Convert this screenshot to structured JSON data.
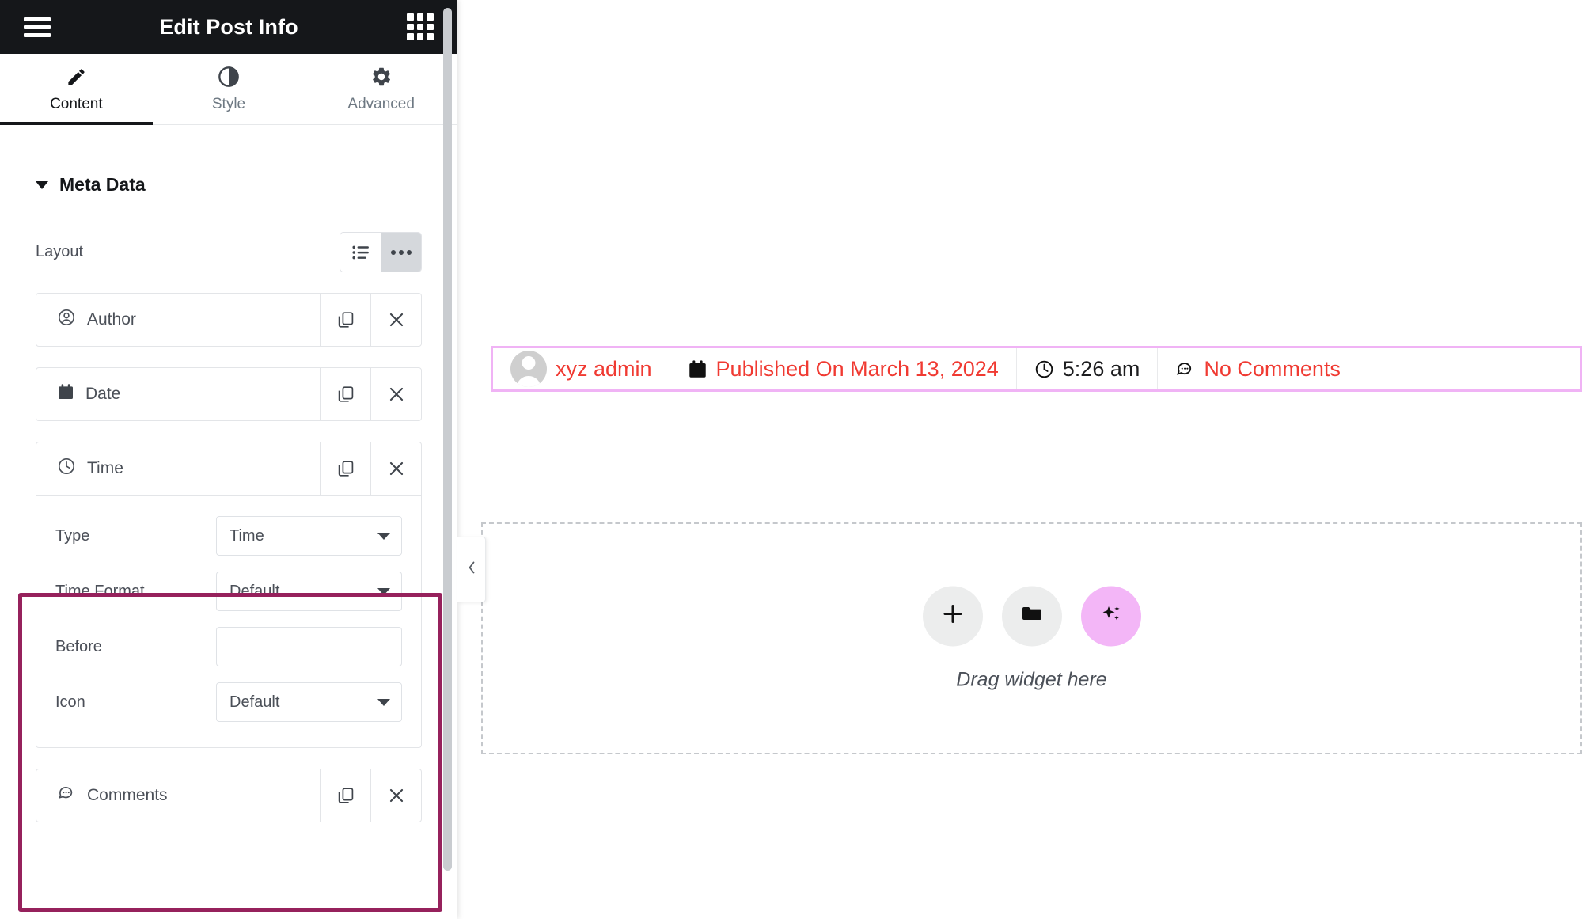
{
  "panel": {
    "header": {
      "title": "Edit Post Info",
      "menu_icon": "hamburger-icon",
      "apps_icon": "grid-apps-icon"
    },
    "tabs": [
      {
        "label": "Content",
        "icon": "pencil-icon",
        "active": true
      },
      {
        "label": "Style",
        "icon": "contrast-icon",
        "active": false
      },
      {
        "label": "Advanced",
        "icon": "gear-icon",
        "active": false
      }
    ],
    "section": {
      "title": "Meta Data",
      "collapsed": false
    },
    "layout_control": {
      "label": "Layout",
      "options": [
        "list",
        "inline"
      ],
      "selected": "inline"
    },
    "items": [
      {
        "label": "Author",
        "icon": "user-circle-icon",
        "open": false
      },
      {
        "label": "Date",
        "icon": "calendar-icon",
        "open": false
      },
      {
        "label": "Time",
        "icon": "clock-icon",
        "open": true,
        "fields": [
          {
            "label": "Type",
            "control": "select",
            "value": "Time"
          },
          {
            "label": "Time Format",
            "control": "select",
            "value": "Default"
          },
          {
            "label": "Before",
            "control": "text",
            "value": "",
            "placeholder": "",
            "dynamic_icon": "database-icon"
          },
          {
            "label": "Icon",
            "control": "select",
            "value": "Default"
          }
        ]
      },
      {
        "label": "Comments",
        "icon": "comment-dots-icon",
        "open": false
      }
    ],
    "row_actions": {
      "duplicate_icon": "copy-icon",
      "remove_icon": "close-x-icon"
    },
    "highlight_color": "#96215c",
    "collapse_handle_icon": "chevron-left-icon"
  },
  "canvas": {
    "meta_bar": {
      "border_color": "#f0b3f5",
      "text_color": "#f03a32",
      "items": [
        {
          "icon": "avatar-image",
          "text": "xyz admin",
          "color": "red"
        },
        {
          "icon": "calendar-icon",
          "text": "Published On March 13, 2024",
          "color": "red"
        },
        {
          "icon": "clock-icon",
          "text": "5:26 am",
          "color": "dark"
        },
        {
          "icon": "comment-dots-icon",
          "text": "No Comments",
          "color": "red"
        }
      ]
    },
    "annotation_arrow": {
      "color": "#96215c",
      "points_to": "5:26 am"
    },
    "dropzone": {
      "text": "Drag widget here",
      "buttons": [
        {
          "icon": "plus-icon",
          "style": "gray"
        },
        {
          "icon": "folder-icon",
          "style": "gray"
        },
        {
          "icon": "ai-sparkle-icon",
          "style": "pink"
        }
      ]
    }
  }
}
